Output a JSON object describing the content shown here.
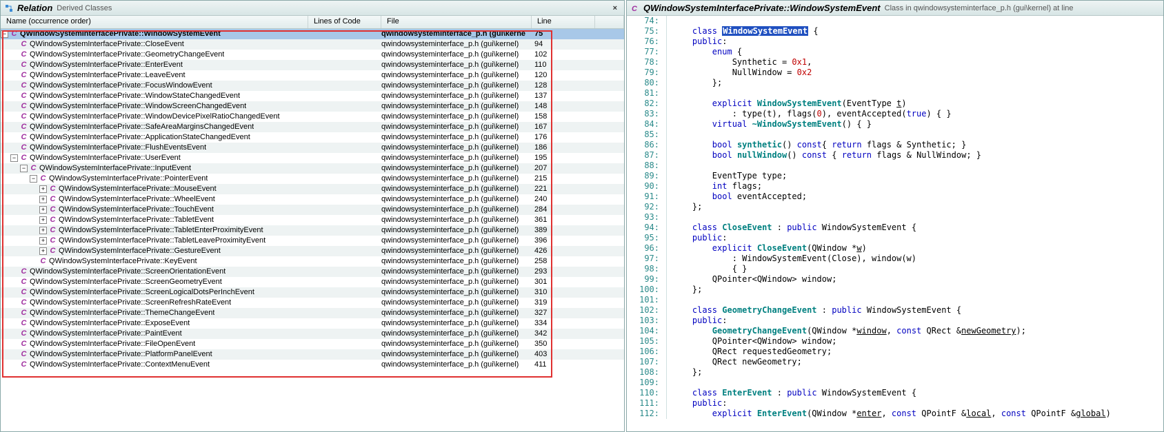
{
  "left": {
    "title": "Relation",
    "subtitle": "Derived Classes",
    "closeGlyph": "×",
    "columns": [
      "Name (occurrence order)",
      "Lines of Code",
      "File",
      "Line"
    ],
    "rows": [
      {
        "d": 0,
        "exp": "-",
        "sel": true,
        "name": "QWindowSystemInterfacePrivate::WindowSystemEvent",
        "file": "qwindowsysteminterface_p.h (gui\\kerne",
        "line": "75"
      },
      {
        "d": 1,
        "exp": "",
        "name": "QWindowSystemInterfacePrivate::CloseEvent",
        "file": "qwindowsysteminterface_p.h (gui\\kernel)",
        "line": "94"
      },
      {
        "d": 1,
        "exp": "",
        "name": "QWindowSystemInterfacePrivate::GeometryChangeEvent",
        "file": "qwindowsysteminterface_p.h (gui\\kernel)",
        "line": "102"
      },
      {
        "d": 1,
        "exp": "",
        "name": "QWindowSystemInterfacePrivate::EnterEvent",
        "file": "qwindowsysteminterface_p.h (gui\\kernel)",
        "line": "110"
      },
      {
        "d": 1,
        "exp": "",
        "name": "QWindowSystemInterfacePrivate::LeaveEvent",
        "file": "qwindowsysteminterface_p.h (gui\\kernel)",
        "line": "120"
      },
      {
        "d": 1,
        "exp": "",
        "name": "QWindowSystemInterfacePrivate::FocusWindowEvent",
        "file": "qwindowsysteminterface_p.h (gui\\kernel)",
        "line": "128"
      },
      {
        "d": 1,
        "exp": "",
        "name": "QWindowSystemInterfacePrivate::WindowStateChangedEvent",
        "file": "qwindowsysteminterface_p.h (gui\\kernel)",
        "line": "137"
      },
      {
        "d": 1,
        "exp": "",
        "name": "QWindowSystemInterfacePrivate::WindowScreenChangedEvent",
        "file": "qwindowsysteminterface_p.h (gui\\kernel)",
        "line": "148"
      },
      {
        "d": 1,
        "exp": "",
        "name": "QWindowSystemInterfacePrivate::WindowDevicePixelRatioChangedEvent",
        "file": "qwindowsysteminterface_p.h (gui\\kernel)",
        "line": "158"
      },
      {
        "d": 1,
        "exp": "",
        "name": "QWindowSystemInterfacePrivate::SafeAreaMarginsChangedEvent",
        "file": "qwindowsysteminterface_p.h (gui\\kernel)",
        "line": "167"
      },
      {
        "d": 1,
        "exp": "",
        "name": "QWindowSystemInterfacePrivate::ApplicationStateChangedEvent",
        "file": "qwindowsysteminterface_p.h (gui\\kernel)",
        "line": "176"
      },
      {
        "d": 1,
        "exp": "",
        "name": "QWindowSystemInterfacePrivate::FlushEventsEvent",
        "file": "qwindowsysteminterface_p.h (gui\\kernel)",
        "line": "186"
      },
      {
        "d": 1,
        "exp": "-",
        "name": "QWindowSystemInterfacePrivate::UserEvent",
        "file": "qwindowsysteminterface_p.h (gui\\kernel)",
        "line": "195"
      },
      {
        "d": 2,
        "exp": "-",
        "name": "QWindowSystemInterfacePrivate::InputEvent",
        "file": "qwindowsysteminterface_p.h (gui\\kernel)",
        "line": "207"
      },
      {
        "d": 3,
        "exp": "-",
        "name": "QWindowSystemInterfacePrivate::PointerEvent",
        "file": "qwindowsysteminterface_p.h (gui\\kernel)",
        "line": "215"
      },
      {
        "d": 4,
        "exp": "+",
        "name": "QWindowSystemInterfacePrivate::MouseEvent",
        "file": "qwindowsysteminterface_p.h (gui\\kernel)",
        "line": "221"
      },
      {
        "d": 4,
        "exp": "+",
        "name": "QWindowSystemInterfacePrivate::WheelEvent",
        "file": "qwindowsysteminterface_p.h (gui\\kernel)",
        "line": "240"
      },
      {
        "d": 4,
        "exp": "+",
        "name": "QWindowSystemInterfacePrivate::TouchEvent",
        "file": "qwindowsysteminterface_p.h (gui\\kernel)",
        "line": "284"
      },
      {
        "d": 4,
        "exp": "+",
        "name": "QWindowSystemInterfacePrivate::TabletEvent",
        "file": "qwindowsysteminterface_p.h (gui\\kernel)",
        "line": "361"
      },
      {
        "d": 4,
        "exp": "+",
        "name": "QWindowSystemInterfacePrivate::TabletEnterProximityEvent",
        "file": "qwindowsysteminterface_p.h (gui\\kernel)",
        "line": "389"
      },
      {
        "d": 4,
        "exp": "+",
        "name": "QWindowSystemInterfacePrivate::TabletLeaveProximityEvent",
        "file": "qwindowsysteminterface_p.h (gui\\kernel)",
        "line": "396"
      },
      {
        "d": 4,
        "exp": "+",
        "name": "QWindowSystemInterfacePrivate::GestureEvent",
        "file": "qwindowsysteminterface_p.h (gui\\kernel)",
        "line": "426"
      },
      {
        "d": 3,
        "exp": "",
        "name": "QWindowSystemInterfacePrivate::KeyEvent",
        "file": "qwindowsysteminterface_p.h (gui\\kernel)",
        "line": "258"
      },
      {
        "d": 1,
        "exp": "",
        "name": "QWindowSystemInterfacePrivate::ScreenOrientationEvent",
        "file": "qwindowsysteminterface_p.h (gui\\kernel)",
        "line": "293"
      },
      {
        "d": 1,
        "exp": "",
        "name": "QWindowSystemInterfacePrivate::ScreenGeometryEvent",
        "file": "qwindowsysteminterface_p.h (gui\\kernel)",
        "line": "301"
      },
      {
        "d": 1,
        "exp": "",
        "name": "QWindowSystemInterfacePrivate::ScreenLogicalDotsPerInchEvent",
        "file": "qwindowsysteminterface_p.h (gui\\kernel)",
        "line": "310"
      },
      {
        "d": 1,
        "exp": "",
        "name": "QWindowSystemInterfacePrivate::ScreenRefreshRateEvent",
        "file": "qwindowsysteminterface_p.h (gui\\kernel)",
        "line": "319"
      },
      {
        "d": 1,
        "exp": "",
        "name": "QWindowSystemInterfacePrivate::ThemeChangeEvent",
        "file": "qwindowsysteminterface_p.h (gui\\kernel)",
        "line": "327"
      },
      {
        "d": 1,
        "exp": "",
        "name": "QWindowSystemInterfacePrivate::ExposeEvent",
        "file": "qwindowsysteminterface_p.h (gui\\kernel)",
        "line": "334"
      },
      {
        "d": 1,
        "exp": "",
        "name": "QWindowSystemInterfacePrivate::PaintEvent",
        "file": "qwindowsysteminterface_p.h (gui\\kernel)",
        "line": "342"
      },
      {
        "d": 1,
        "exp": "",
        "name": "QWindowSystemInterfacePrivate::FileOpenEvent",
        "file": "qwindowsysteminterface_p.h (gui\\kernel)",
        "line": "350"
      },
      {
        "d": 1,
        "exp": "",
        "name": "QWindowSystemInterfacePrivate::PlatformPanelEvent",
        "file": "qwindowsysteminterface_p.h (gui\\kernel)",
        "line": "403"
      },
      {
        "d": 1,
        "exp": "",
        "name": "QWindowSystemInterfacePrivate::ContextMenuEvent",
        "file": "qwindowsysteminterface_p.h (gui\\kernel)",
        "line": "411"
      }
    ]
  },
  "right": {
    "title": "QWindowSystemInterfacePrivate::WindowSystemEvent",
    "subtitle": "Class in qwindowsysteminterface_p.h (gui\\kernel) at line",
    "lines": [
      {
        "n": 74,
        "h": ""
      },
      {
        "n": 75,
        "h": "    <span class='kw'>class</span> <span class='hlsel'>WindowSystemEvent</span> {"
      },
      {
        "n": 76,
        "h": "    <span class='kw'>public</span>:"
      },
      {
        "n": 77,
        "h": "        <span class='kw'>enum</span> {"
      },
      {
        "n": 78,
        "h": "            Synthetic = <span class='num'>0x1</span>,"
      },
      {
        "n": 79,
        "h": "            NullWindow = <span class='num'>0x2</span>"
      },
      {
        "n": 80,
        "h": "        };"
      },
      {
        "n": 81,
        "h": ""
      },
      {
        "n": 82,
        "h": "        <span class='kw'>explicit</span> <span class='fn'>WindowSystemEvent</span>(EventType <span class='ul'>t</span>)"
      },
      {
        "n": 83,
        "h": "            : type(t), flags(<span class='num'>0</span>), eventAccepted(<span class='kw'>true</span>) { }"
      },
      {
        "n": 84,
        "h": "        <span class='kw'>virtual</span> <span class='fn'>~WindowSystemEvent</span>() { }"
      },
      {
        "n": 85,
        "h": ""
      },
      {
        "n": 86,
        "h": "        <span class='kw'>bool</span> <span class='fn'>synthetic</span>() <span class='kw'>const</span>{ <span class='kw'>return</span> flags &amp; Synthetic; }"
      },
      {
        "n": 87,
        "h": "        <span class='kw'>bool</span> <span class='fn'>nullWindow</span>() <span class='kw'>const</span> { <span class='kw'>return</span> flags &amp; NullWindow; }"
      },
      {
        "n": 88,
        "h": ""
      },
      {
        "n": 89,
        "h": "        EventType type;"
      },
      {
        "n": 90,
        "h": "        <span class='kw'>int</span> flags;"
      },
      {
        "n": 91,
        "h": "        <span class='kw'>bool</span> eventAccepted;"
      },
      {
        "n": 92,
        "h": "    };"
      },
      {
        "n": 93,
        "h": ""
      },
      {
        "n": 94,
        "h": "    <span class='kw'>class</span> <span class='fn'>CloseEvent</span> : <span class='kw'>public</span> WindowSystemEvent {"
      },
      {
        "n": 95,
        "h": "    <span class='kw'>public</span>:"
      },
      {
        "n": 96,
        "h": "        <span class='kw'>explicit</span> <span class='fn'>CloseEvent</span>(QWindow *<span class='ul'>w</span>)"
      },
      {
        "n": 97,
        "h": "            : WindowSystemEvent(Close), window(w)"
      },
      {
        "n": 98,
        "h": "            { }"
      },
      {
        "n": 99,
        "h": "        QPointer&lt;QWindow&gt; window;"
      },
      {
        "n": 100,
        "h": "    };"
      },
      {
        "n": 101,
        "h": ""
      },
      {
        "n": 102,
        "h": "    <span class='kw'>class</span> <span class='fn'>GeometryChangeEvent</span> : <span class='kw'>public</span> WindowSystemEvent {"
      },
      {
        "n": 103,
        "h": "    <span class='kw'>public</span>:"
      },
      {
        "n": 104,
        "h": "        <span class='fn'>GeometryChangeEvent</span>(QWindow *<span class='ul'>window</span>, <span class='kw'>const</span> QRect &amp;<span class='ul'>newGeometry</span>);"
      },
      {
        "n": 105,
        "h": "        QPointer&lt;QWindow&gt; window;"
      },
      {
        "n": 106,
        "h": "        QRect requestedGeometry;"
      },
      {
        "n": 107,
        "h": "        QRect newGeometry;"
      },
      {
        "n": 108,
        "h": "    };"
      },
      {
        "n": 109,
        "h": ""
      },
      {
        "n": 110,
        "h": "    <span class='kw'>class</span> <span class='fn'>EnterEvent</span> : <span class='kw'>public</span> WindowSystemEvent {"
      },
      {
        "n": 111,
        "h": "    <span class='kw'>public</span>:"
      },
      {
        "n": 112,
        "h": "        <span class='kw'>explicit</span> <span class='fn'>EnterEvent</span>(QWindow *<span class='ul'>enter</span>, <span class='kw'>const</span> QPointF &amp;<span class='ul'>local</span>, <span class='kw'>const</span> QPointF &amp;<span class='ul'>global</span>)"
      }
    ]
  }
}
